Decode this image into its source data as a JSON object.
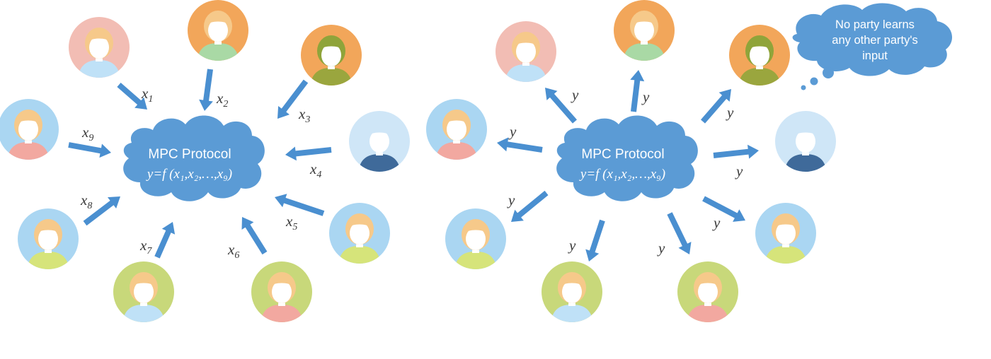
{
  "colors": {
    "arrow": "#4a8fd0",
    "cloud": "#5b9bd5",
    "label": "#3a3a3a",
    "face": "#ffffff",
    "hair_light": "#f6c98a",
    "hair_green": "#8fa43a",
    "hair_ghost": "#cfe6f7",
    "bg_pink": "#f2bdb4",
    "bg_orange": "#f2a65a",
    "bg_blue": "#aad6f2",
    "bg_pale": "#cfe6f7",
    "bg_green": "#c8d87a",
    "shirt_blue": "#bfe1f7",
    "shirt_green": "#a9d9a5",
    "shirt_pink": "#f2a8a0",
    "shirt_olive": "#9aa63e",
    "shirt_navy": "#3f6a9a",
    "shirt_yellow": "#d6e47a",
    "shirt_orange": "#f7c97a"
  },
  "left": {
    "cloud_title": "MPC Protocol",
    "cloud_formula": "y=f (x₁,x₂,…,x₉)",
    "arrow_labels": [
      {
        "base": "x",
        "sub": "1"
      },
      {
        "base": "x",
        "sub": "2"
      },
      {
        "base": "x",
        "sub": "3"
      },
      {
        "base": "x",
        "sub": "4"
      },
      {
        "base": "x",
        "sub": "5"
      },
      {
        "base": "x",
        "sub": "6"
      },
      {
        "base": "x",
        "sub": "7"
      },
      {
        "base": "x",
        "sub": "8"
      },
      {
        "base": "x",
        "sub": "9"
      }
    ]
  },
  "right": {
    "cloud_title": "MPC Protocol",
    "cloud_formula": "y=f (x₁,x₂,…,x₉)",
    "output_label": "y",
    "thought_lines": [
      "No party learns",
      "any other party's",
      "input"
    ]
  }
}
